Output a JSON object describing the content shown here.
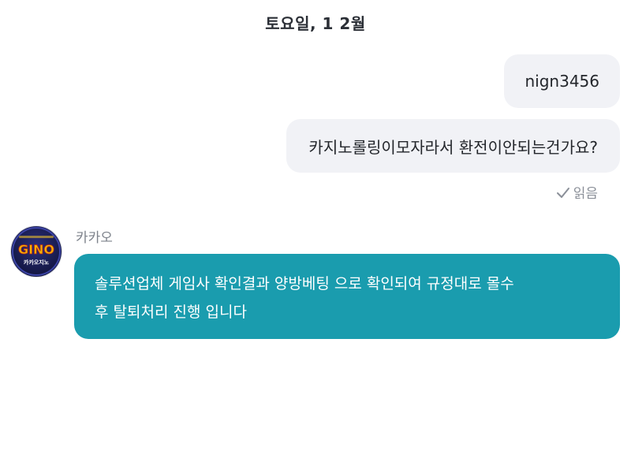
{
  "chat": {
    "date_header": "토요일, 1 2월",
    "messages_out": [
      {
        "text": "nign3456"
      },
      {
        "text": "카지노롤링이모자라서 환전이안되는건가요?"
      }
    ],
    "read_receipt": "읽음",
    "incoming": {
      "sender_name": "카카오",
      "avatar": {
        "logo_text": "GINO",
        "logo_subtext": "카카오지노"
      },
      "lines": [
        "솔루션업체 게임사 확인결과 양방베팅 으로 확인되여 규정대로 몰수",
        "후 탈퇴처리 진행 입니다"
      ]
    }
  },
  "colors": {
    "outgoing_bubble": "#f1f2f6",
    "incoming_bubble": "#1a9cae",
    "read_receipt": "#8a8f98"
  },
  "icons": {
    "read_check": "check-icon",
    "avatar_logo": "gino-logo"
  }
}
